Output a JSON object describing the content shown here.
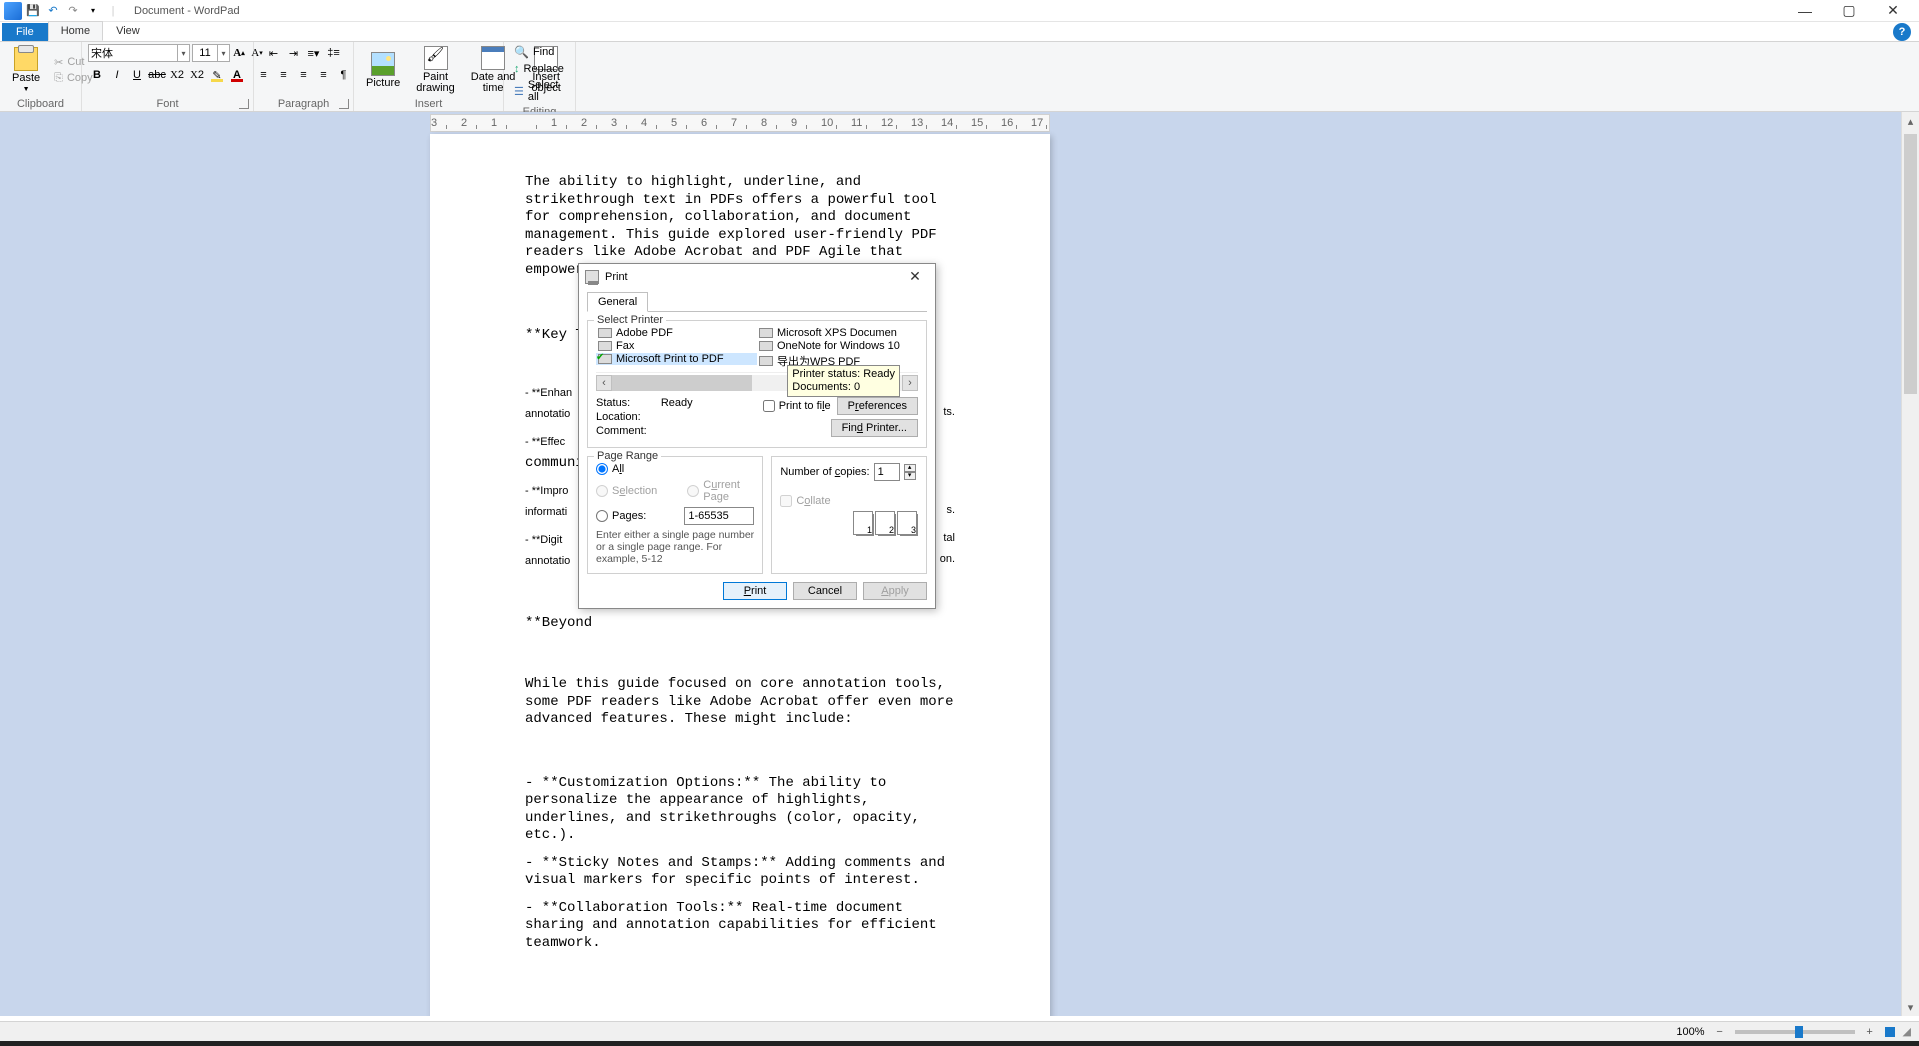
{
  "title": "Document - WordPad",
  "tabs": {
    "file": "File",
    "home": "Home",
    "view": "View"
  },
  "clipboard": {
    "paste": "Paste",
    "cut": "Cut",
    "copy": "Copy",
    "label": "Clipboard"
  },
  "font": {
    "name": "宋体",
    "size": "11",
    "label": "Font"
  },
  "paragraph": {
    "label": "Paragraph"
  },
  "insert": {
    "picture": "Picture",
    "paint": "Paint\ndrawing",
    "date": "Date and\ntime",
    "object": "Insert\nobject",
    "label": "Insert"
  },
  "editing": {
    "find": "Find",
    "replace": "Replace",
    "selectall": "Select all",
    "label": "Editing"
  },
  "document": {
    "p1": "The ability to highlight, underline, and strikethrough text in PDFs offers a powerful tool for comprehension, collaboration, and document management. This guide explored user-friendly PDF readers like Adobe Acrobat and PDF Agile that empower you to annotate your documents with ease.",
    "p2": "**Key Tak",
    "p3": "- **Enhan",
    "p3b": "annotatio",
    "p4": "- **Effec",
    "p4b": "communica",
    "p5": "- **Impro",
    "p5b": "informati",
    "p6": "- **Digit",
    "p6b": "annotatio",
    "p7": "**Beyond ",
    "p8a": "ts.",
    "p8b": "s.",
    "p8c": "tal",
    "p8d": "on.",
    "p9": "While this guide focused on core annotation tools, some PDF readers like Adobe Acrobat offer even more advanced features. These might include:",
    "p10": "- **Customization Options:** The ability to personalize the appearance of highlights, underlines, and strikethroughs (color, opacity, etc.).",
    "p11": "- **Sticky Notes and Stamps:** Adding comments and visual markers for specific points of interest.",
    "p12": "- **Collaboration Tools:** Real-time document sharing and annotation capabilities for efficient teamwork."
  },
  "print": {
    "title": "Print",
    "tab": "General",
    "selectPrinter": "Select Printer",
    "printers": {
      "adobe": "Adobe PDF",
      "fax": "Fax",
      "mstopdf": "Microsoft Print to PDF",
      "msxps": "Microsoft XPS Documen",
      "onenote": "OneNote for Windows 10",
      "wps": "导出为WPS PDF"
    },
    "tooltip1": "Printer status: Ready",
    "tooltip2": "Documents: 0",
    "statusLbl": "Status:",
    "statusVal": "Ready",
    "locationLbl": "Location:",
    "commentLbl": "Comment:",
    "printToFile": "Print to file",
    "preferences": "Preferences",
    "findPrinter": "Find Printer...",
    "pageRange": "Page Range",
    "all": "All",
    "selection": "Selection",
    "currentPage": "Current Page",
    "pages": "Pages:",
    "pagesVal": "1-65535",
    "hint": "Enter either a single page number or a single page range.  For example, 5-12",
    "copiesLbl": "Number of copies:",
    "copiesVal": "1",
    "collate": "Collate",
    "btnPrint": "Print",
    "btnCancel": "Cancel",
    "btnApply": "Apply"
  },
  "status": {
    "zoom": "100%"
  }
}
